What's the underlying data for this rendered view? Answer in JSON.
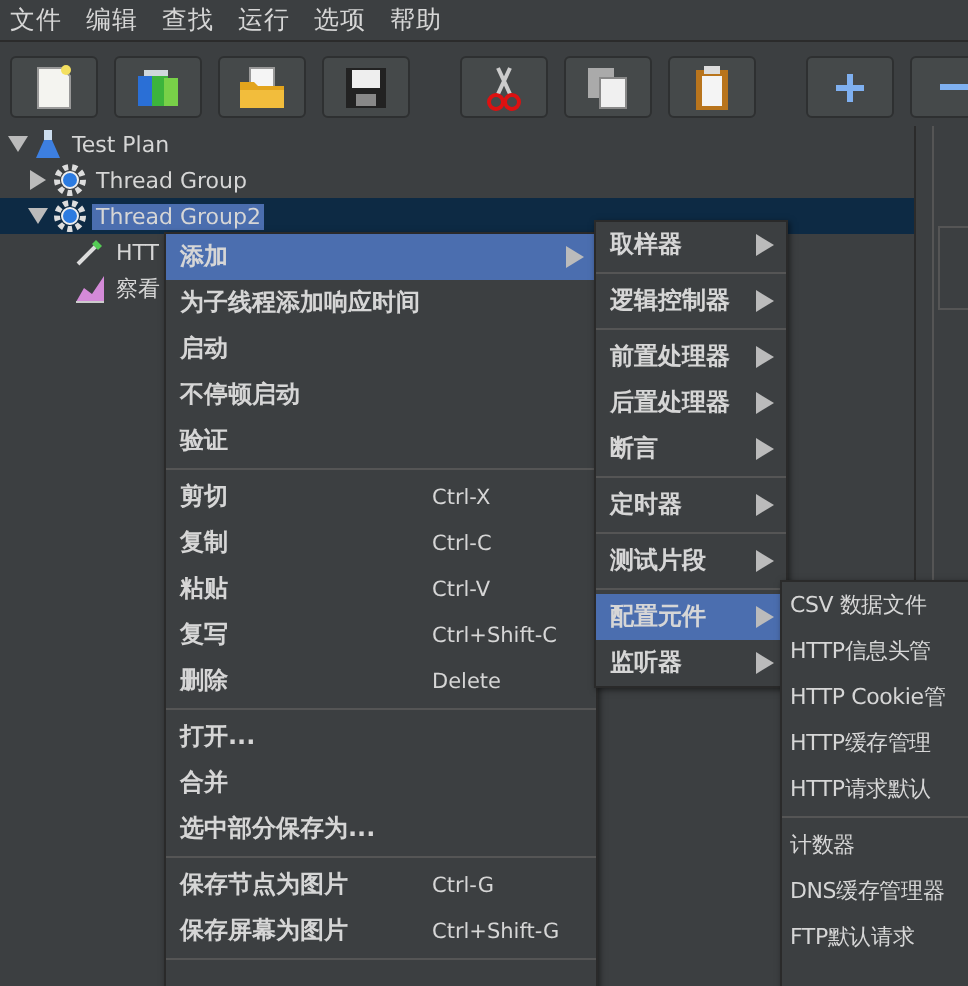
{
  "menubar": [
    "文件",
    "编辑",
    "查找",
    "运行",
    "选项",
    "帮助"
  ],
  "tree": [
    {
      "label": "Test Plan",
      "kind": "plan",
      "expanded": true,
      "selected": false,
      "children": [
        {
          "label": "Thread Group",
          "kind": "thread_group",
          "expanded": false,
          "selected": false
        },
        {
          "label": "Thread Group2",
          "kind": "thread_group",
          "expanded": true,
          "selected": true,
          "children": [
            {
              "label": "HTT",
              "kind": "sampler",
              "selected": false
            },
            {
              "label": "察看",
              "kind": "listener",
              "selected": false
            }
          ]
        }
      ]
    }
  ],
  "context_menu": [
    {
      "kind": "item",
      "label": "添加",
      "submenu": true,
      "selected": true
    },
    {
      "kind": "item",
      "label": "为子线程添加响应时间",
      "selected": false
    },
    {
      "kind": "item",
      "label": "启动",
      "selected": false
    },
    {
      "kind": "item",
      "label": "不停顿启动",
      "selected": false
    },
    {
      "kind": "item",
      "label": "验证",
      "selected": false
    },
    {
      "kind": "separator"
    },
    {
      "kind": "item",
      "label": "剪切",
      "shortcut": "Ctrl-X",
      "selected": false
    },
    {
      "kind": "item",
      "label": "复制",
      "shortcut": "Ctrl-C",
      "selected": false
    },
    {
      "kind": "item",
      "label": "粘贴",
      "shortcut": "Ctrl-V",
      "selected": false
    },
    {
      "kind": "item",
      "label": "复写",
      "shortcut": "Ctrl+Shift-C",
      "selected": false
    },
    {
      "kind": "item",
      "label": "删除",
      "shortcut": "Delete",
      "selected": false
    },
    {
      "kind": "separator"
    },
    {
      "kind": "item",
      "label": "打开...",
      "selected": false
    },
    {
      "kind": "item",
      "label": "合并",
      "selected": false
    },
    {
      "kind": "item",
      "label": "选中部分保存为...",
      "selected": false
    },
    {
      "kind": "separator"
    },
    {
      "kind": "item",
      "label": "保存节点为图片",
      "shortcut": "Ctrl-G",
      "selected": false
    },
    {
      "kind": "item",
      "label": "保存屏幕为图片",
      "shortcut": "Ctrl+Shift-G",
      "selected": false
    },
    {
      "kind": "separator"
    }
  ],
  "add_submenu": [
    {
      "kind": "item",
      "label": "取样器",
      "submenu": true,
      "selected": false
    },
    {
      "kind": "separator"
    },
    {
      "kind": "item",
      "label": "逻辑控制器",
      "submenu": true,
      "selected": false
    },
    {
      "kind": "separator"
    },
    {
      "kind": "item",
      "label": "前置处理器",
      "submenu": true,
      "selected": false
    },
    {
      "kind": "item",
      "label": "后置处理器",
      "submenu": true,
      "selected": false
    },
    {
      "kind": "item",
      "label": "断言",
      "submenu": true,
      "selected": false
    },
    {
      "kind": "separator"
    },
    {
      "kind": "item",
      "label": "定时器",
      "submenu": true,
      "selected": false
    },
    {
      "kind": "separator"
    },
    {
      "kind": "item",
      "label": "测试片段",
      "submenu": true,
      "selected": false
    },
    {
      "kind": "separator"
    },
    {
      "kind": "item",
      "label": "配置元件",
      "submenu": true,
      "selected": true
    },
    {
      "kind": "item",
      "label": "监听器",
      "submenu": true,
      "selected": false
    }
  ],
  "config_submenu": [
    {
      "kind": "item",
      "label": "CSV 数据文件",
      "selected": false
    },
    {
      "kind": "item",
      "label": "HTTP信息头管",
      "selected": false
    },
    {
      "kind": "item",
      "label": "HTTP Cookie管",
      "selected": false
    },
    {
      "kind": "item",
      "label": "HTTP缓存管理",
      "selected": false
    },
    {
      "kind": "item",
      "label": "HTTP请求默认",
      "selected": false
    },
    {
      "kind": "separator"
    },
    {
      "kind": "item",
      "label": "计数器",
      "selected": false
    },
    {
      "kind": "item",
      "label": "DNS缓存管理器",
      "selected": false
    },
    {
      "kind": "item",
      "label": "FTP默认请求",
      "selected": false
    }
  ]
}
